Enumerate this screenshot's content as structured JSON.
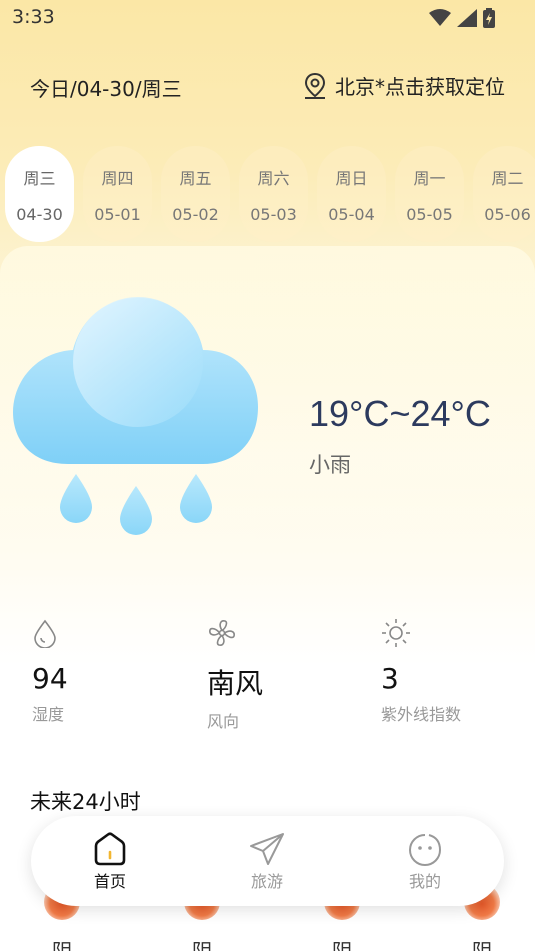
{
  "status_bar": {
    "time": "3:33"
  },
  "header": {
    "date": "今日/04-30/周三",
    "location": "北京*点击获取定位"
  },
  "days": [
    {
      "weekday": "周三",
      "date": "04-30",
      "active": true
    },
    {
      "weekday": "周四",
      "date": "05-01"
    },
    {
      "weekday": "周五",
      "date": "05-02"
    },
    {
      "weekday": "周六",
      "date": "05-03"
    },
    {
      "weekday": "周日",
      "date": "05-04"
    },
    {
      "weekday": "周一",
      "date": "05-05"
    },
    {
      "weekday": "周二",
      "date": "05-06"
    }
  ],
  "weather": {
    "temp_range": "19°C~24°C",
    "condition": "小雨",
    "icon": "rain-cloud-icon"
  },
  "stats": [
    {
      "value": "94",
      "label": "湿度",
      "icon": "humidity-drop-icon"
    },
    {
      "value": "南风",
      "label": "风向",
      "icon": "fan-icon"
    },
    {
      "value": "3",
      "label": "紫外线指数",
      "icon": "sun-icon"
    }
  ],
  "forecast": {
    "title": "未来24小时",
    "hours": [
      {
        "label": "阴"
      },
      {
        "label": "阴"
      },
      {
        "label": "阴"
      },
      {
        "label": "阴"
      }
    ]
  },
  "nav": [
    {
      "label": "首页",
      "icon": "home-icon",
      "active": true
    },
    {
      "label": "旅游",
      "icon": "paper-plane-icon"
    },
    {
      "label": "我的",
      "icon": "face-icon"
    }
  ],
  "colors": {
    "accent_text": "#2c3a5e",
    "cloud": "#8fd6f8",
    "dot": "#e85a2a"
  }
}
